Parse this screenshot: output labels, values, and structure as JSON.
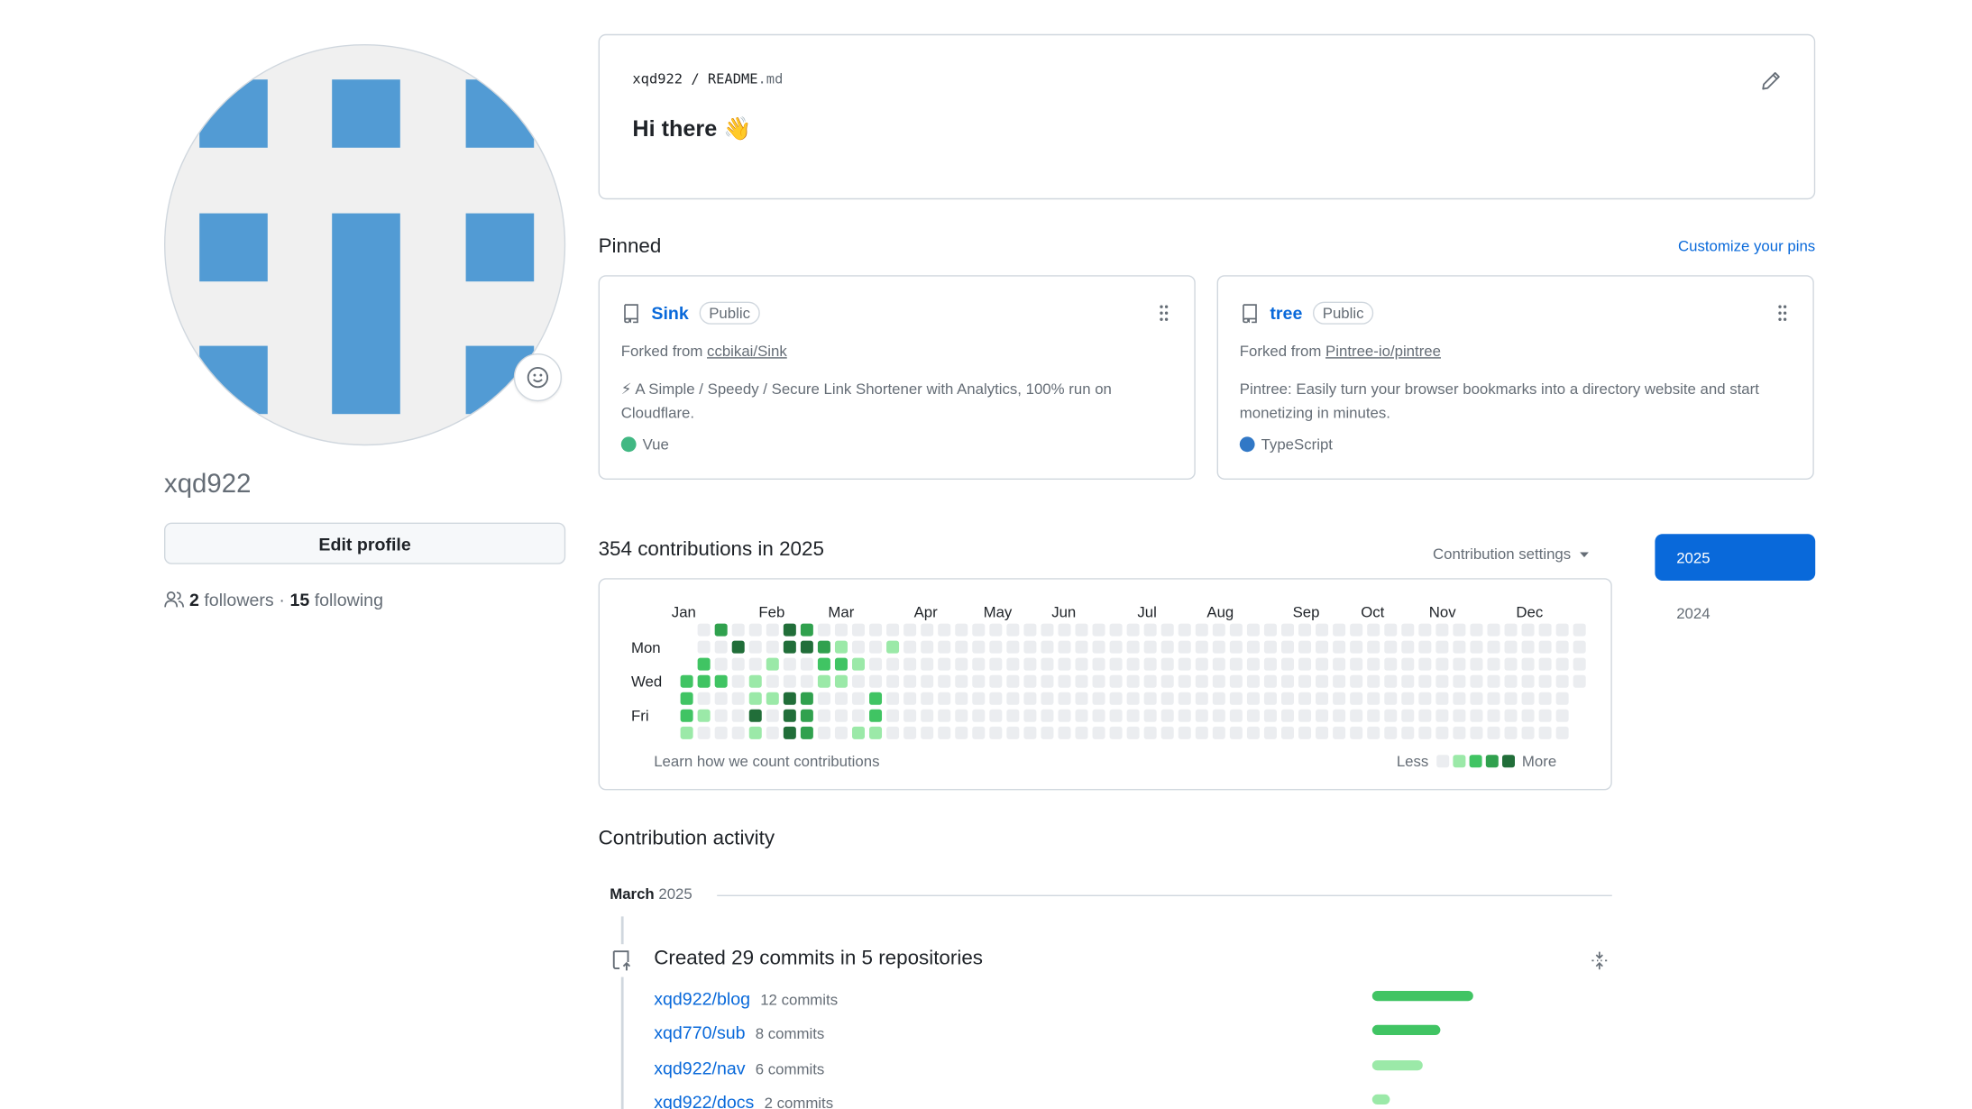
{
  "profile": {
    "username": "xqd922",
    "edit_label": "Edit profile",
    "followers_count": "2",
    "followers_label": "followers",
    "separator": "·",
    "following_count": "15",
    "following_label": "following",
    "avatar_color": "#529bd4"
  },
  "readme": {
    "owner": "xqd922",
    "sep": "/",
    "file": "README",
    "ext": ".md",
    "heading": "Hi there 👋"
  },
  "pinned": {
    "title": "Pinned",
    "customize_label": "Customize your pins",
    "cards": [
      {
        "name": "Sink",
        "visibility": "Public",
        "forked_prefix": "Forked from",
        "forked_from": "ccbikai/Sink",
        "description": "⚡ A Simple / Speedy / Secure Link Shortener with Analytics, 100% run on Cloudflare.",
        "language": "Vue",
        "language_color": "#41b883"
      },
      {
        "name": "tree",
        "visibility": "Public",
        "forked_prefix": "Forked from",
        "forked_from": "Pintree-io/pintree",
        "description": "Pintree: Easily turn your browser bookmarks into a directory website and start monetizing in minutes.",
        "language": "TypeScript",
        "language_color": "#3178c6"
      }
    ]
  },
  "contributions": {
    "title": "354 contributions in 2025",
    "settings_label": "Contribution settings",
    "months": [
      "Jan",
      "Feb",
      "Mar",
      "Apr",
      "May",
      "Jun",
      "Jul",
      "Aug",
      "Sep",
      "Oct",
      "Nov",
      "Dec"
    ],
    "day_labels": [
      "Mon",
      "Wed",
      "Fri"
    ],
    "learn_label": "Learn how we count contributions",
    "legend_less": "Less",
    "legend_more": "More",
    "level_colors": [
      "#ebedf0",
      "#9be9a8",
      "#40c463",
      "#30a14e",
      "#216e39"
    ],
    "years": [
      "2025",
      "2024"
    ],
    "selected_year": "2025"
  },
  "activity": {
    "title": "Contribution activity",
    "month": "March",
    "year": "2025",
    "heading": "Created 29 commits in 5 repositories",
    "repos": [
      {
        "name": "xqd922/blog",
        "commits": "12 commits",
        "share": 1.0,
        "color": "#40c463"
      },
      {
        "name": "xqd770/sub",
        "commits": "8 commits",
        "share": 0.67,
        "color": "#40c463"
      },
      {
        "name": "xqd922/nav",
        "commits": "6 commits",
        "share": 0.5,
        "color": "#9be9a8"
      },
      {
        "name": "xqd922/docs",
        "commits": "2 commits",
        "share": 0.17,
        "color": "#9be9a8"
      }
    ]
  }
}
